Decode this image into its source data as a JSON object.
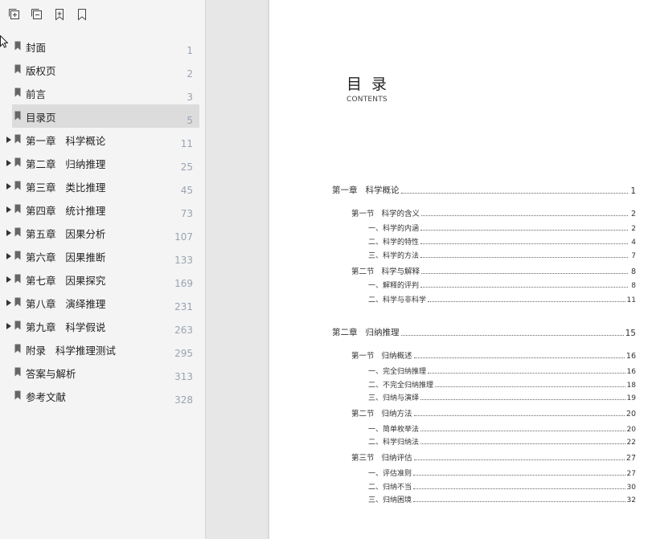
{
  "toolbar": {
    "icons": [
      "expand-all-icon",
      "collapse-all-icon",
      "add-bookmark-icon",
      "bookmark-icon"
    ]
  },
  "outline": [
    {
      "label": "封面",
      "page": "1",
      "expandable": false
    },
    {
      "label": "版权页",
      "page": "2",
      "expandable": false
    },
    {
      "label": "前言",
      "page": "3",
      "expandable": false
    },
    {
      "label": "目录页",
      "page": "5",
      "expandable": false,
      "selected": true
    },
    {
      "label": "第一章   科学概论",
      "page": "11",
      "expandable": true
    },
    {
      "label": "第二章   归纳推理",
      "page": "25",
      "expandable": true
    },
    {
      "label": "第三章   类比推理",
      "page": "45",
      "expandable": true
    },
    {
      "label": "第四章   统计推理",
      "page": "73",
      "expandable": true
    },
    {
      "label": "第五章   因果分析",
      "page": "107",
      "expandable": true
    },
    {
      "label": "第六章   因果推断",
      "page": "133",
      "expandable": true
    },
    {
      "label": "第七章   因果探究",
      "page": "169",
      "expandable": true
    },
    {
      "label": "第八章   演绎推理",
      "page": "231",
      "expandable": true
    },
    {
      "label": "第九章   科学假说",
      "page": "263",
      "expandable": true
    },
    {
      "label": "附录   科学推理测试",
      "page": "295",
      "expandable": false
    },
    {
      "label": "答案与解析",
      "page": "313",
      "expandable": false
    },
    {
      "label": "参考文献",
      "page": "328",
      "expandable": false
    }
  ],
  "page": {
    "title": "目 录",
    "subtitle": "CONTENTS",
    "toc": [
      {
        "level": 1,
        "text": "第一章   科学概论",
        "page": "1"
      },
      {
        "level": 2,
        "text": "第一节   科学的含义",
        "page": "2"
      },
      {
        "level": 3,
        "text": "一、科学的内涵",
        "page": "2"
      },
      {
        "level": 3,
        "text": "二、科学的特性",
        "page": "4"
      },
      {
        "level": 3,
        "text": "三、科学的方法",
        "page": "7"
      },
      {
        "level": 2,
        "text": "第二节   科学与解释",
        "page": "8"
      },
      {
        "level": 3,
        "text": "一、解释的评判",
        "page": "8"
      },
      {
        "level": 3,
        "text": "二、科学与非科学",
        "page": "11"
      },
      {
        "level": 1,
        "text": "第二章   归纳推理",
        "page": "15"
      },
      {
        "level": 2,
        "text": "第一节   归纳概述",
        "page": "16"
      },
      {
        "level": 3,
        "text": "一、完全归纳推理",
        "page": "16"
      },
      {
        "level": 3,
        "text": "二、不完全归纳推理",
        "page": "18"
      },
      {
        "level": 3,
        "text": "三、归纳与演绎",
        "page": "19"
      },
      {
        "level": 2,
        "text": "第二节   归纳方法",
        "page": "20"
      },
      {
        "level": 3,
        "text": "一、简单枚举法",
        "page": "20"
      },
      {
        "level": 3,
        "text": "二、科学归纳法",
        "page": "22"
      },
      {
        "level": 2,
        "text": "第三节   归纳评估",
        "page": "27"
      },
      {
        "level": 3,
        "text": "一、评估准则",
        "page": "27"
      },
      {
        "level": 3,
        "text": "二、归纳不当",
        "page": "30"
      },
      {
        "level": 3,
        "text": "三、归纳困境",
        "page": "32"
      }
    ]
  }
}
